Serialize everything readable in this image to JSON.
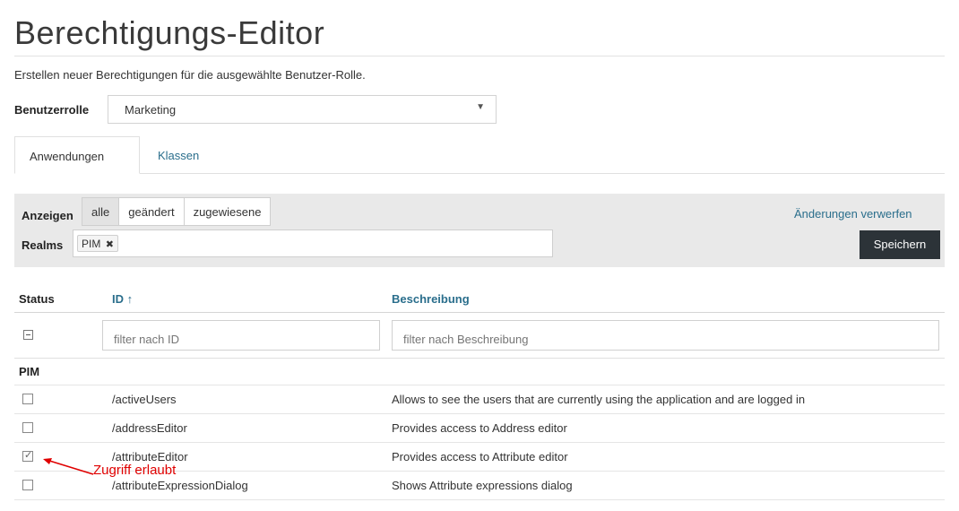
{
  "page": {
    "title": "Berechtigungs-Editor",
    "subtitle": "Erstellen neuer Berechtigungen für die ausgewählte Benutzer-Rolle."
  },
  "role": {
    "label": "Benutzerrolle",
    "selected": "Marketing"
  },
  "tabs": [
    {
      "label": "Anwendungen",
      "active": true
    },
    {
      "label": "Klassen",
      "active": false
    }
  ],
  "filters": {
    "show_label": "Anzeigen",
    "options": [
      "alle",
      "geändert",
      "zugewiesene"
    ],
    "active_option": "alle",
    "discard_label": "Änderungen verwerfen",
    "realms_label": "Realms",
    "realm_tags": [
      "PIM"
    ],
    "save_label": "Speichern"
  },
  "table": {
    "headers": {
      "status": "Status",
      "id": "ID",
      "desc": "Beschreibung",
      "sort_arrow": "↑"
    },
    "filter_placeholders": {
      "id": "filter nach ID",
      "desc": "filter nach Beschreibung"
    },
    "group": "PIM",
    "rows": [
      {
        "id": "/activeUsers",
        "desc": "Allows to see the users that are currently using the application and are logged in",
        "checked": false
      },
      {
        "id": "/addressEditor",
        "desc": "Provides access to Address editor",
        "checked": false
      },
      {
        "id": "/attributeEditor",
        "desc": "Provides access to Attribute editor",
        "checked": true
      },
      {
        "id": "/attributeExpressionDialog",
        "desc": "Shows Attribute expressions dialog",
        "checked": false
      }
    ]
  },
  "annotation": {
    "text": "Zugriff erlaubt",
    "color": "#e00000"
  },
  "colors": {
    "link": "#2a6e8c",
    "save_button": "#2c3338",
    "panel": "#e9e9e9"
  }
}
